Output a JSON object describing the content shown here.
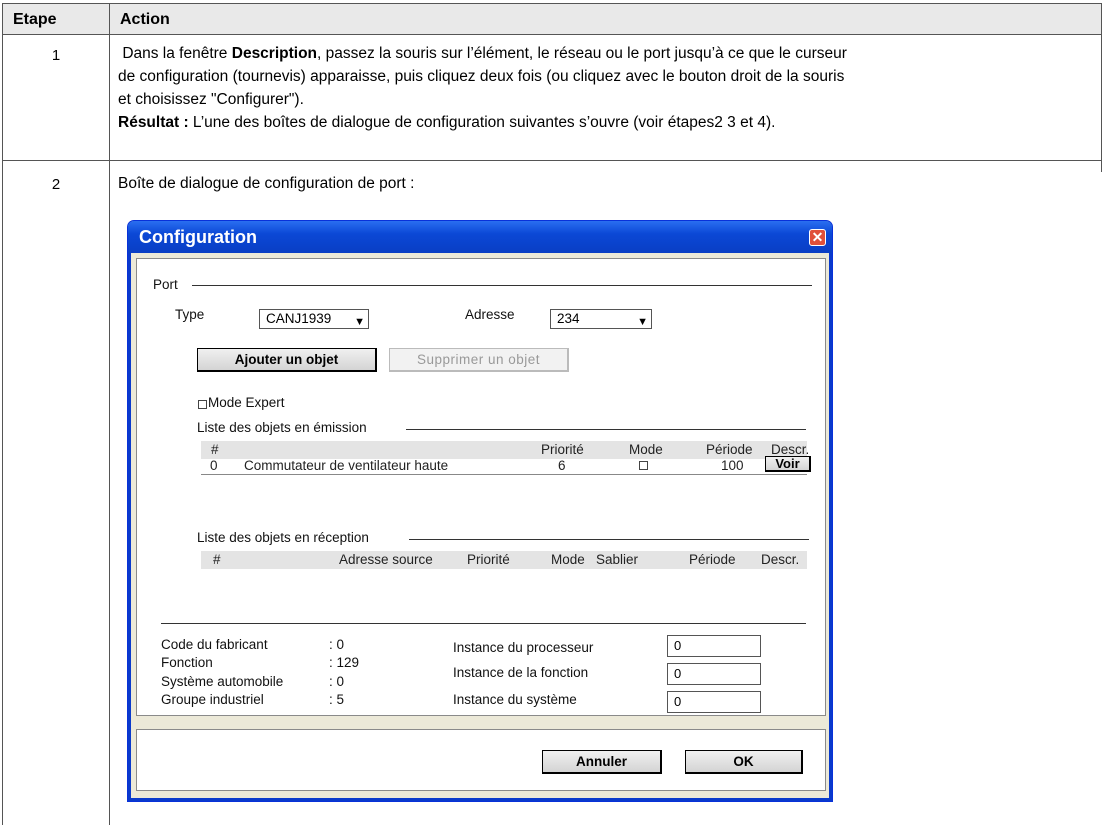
{
  "table": {
    "header_etape": "Etape",
    "header_action": "Action",
    "rows": [
      {
        "num": "1",
        "line1_pre": "Dans la fenêtre ",
        "line1_bold": "Description",
        "line1_post": ", passez la souris sur l’élément, le réseau ou le port jusqu’à ce que le curseur",
        "line2": "de configuration (tournevis) apparaisse, puis cliquez deux fois (ou cliquez avec le bouton droit de la souris",
        "line3": "et choisissez \"Configurer\").",
        "line4_bold": "Résultat :",
        "line4_post": " L’une des boîtes de dialogue de configuration suivantes s’ouvre (voir étapes2 3 et 4)."
      },
      {
        "num": "2",
        "text": "Boîte de dialogue de configuration de port :"
      }
    ]
  },
  "dialog": {
    "title": "Configuration",
    "close_glyph": "✕",
    "port_section": "Port",
    "type_label": "Type",
    "type_value": "CANJ1939",
    "address_label": "Adresse",
    "address_value": "234",
    "add_button": "Ajouter un objet",
    "remove_button": "Supprimer un objet",
    "expert_mode": "Mode Expert",
    "emission_section": "Liste des objets en émission",
    "emission_columns": [
      "#",
      "Priorité",
      "Mode",
      "Période",
      "Descr."
    ],
    "emission_rows": [
      {
        "num": "0",
        "name": "Commutateur de ventilateur haute",
        "priority": "6",
        "period": "100",
        "descr_button": "Voir"
      }
    ],
    "reception_section": "Liste des objets en réception",
    "reception_columns": [
      "#",
      "Adresse source",
      "Priorité",
      "Mode",
      "Sablier",
      "Période",
      "Descr."
    ],
    "info": [
      {
        "label": "Code du fabricant",
        "value": ": 0"
      },
      {
        "label": "Fonction",
        "value": ": 129"
      },
      {
        "label": "Système automobile",
        "value": ": 0"
      },
      {
        "label": "Groupe industriel",
        "value": ": 5"
      }
    ],
    "instances": [
      {
        "label": "Instance du processeur",
        "value": "0"
      },
      {
        "label": "Instance de la fonction",
        "value": "0"
      },
      {
        "label": "Instance du système",
        "value": "0"
      }
    ],
    "cancel_button": "Annuler",
    "ok_button": "OK"
  }
}
